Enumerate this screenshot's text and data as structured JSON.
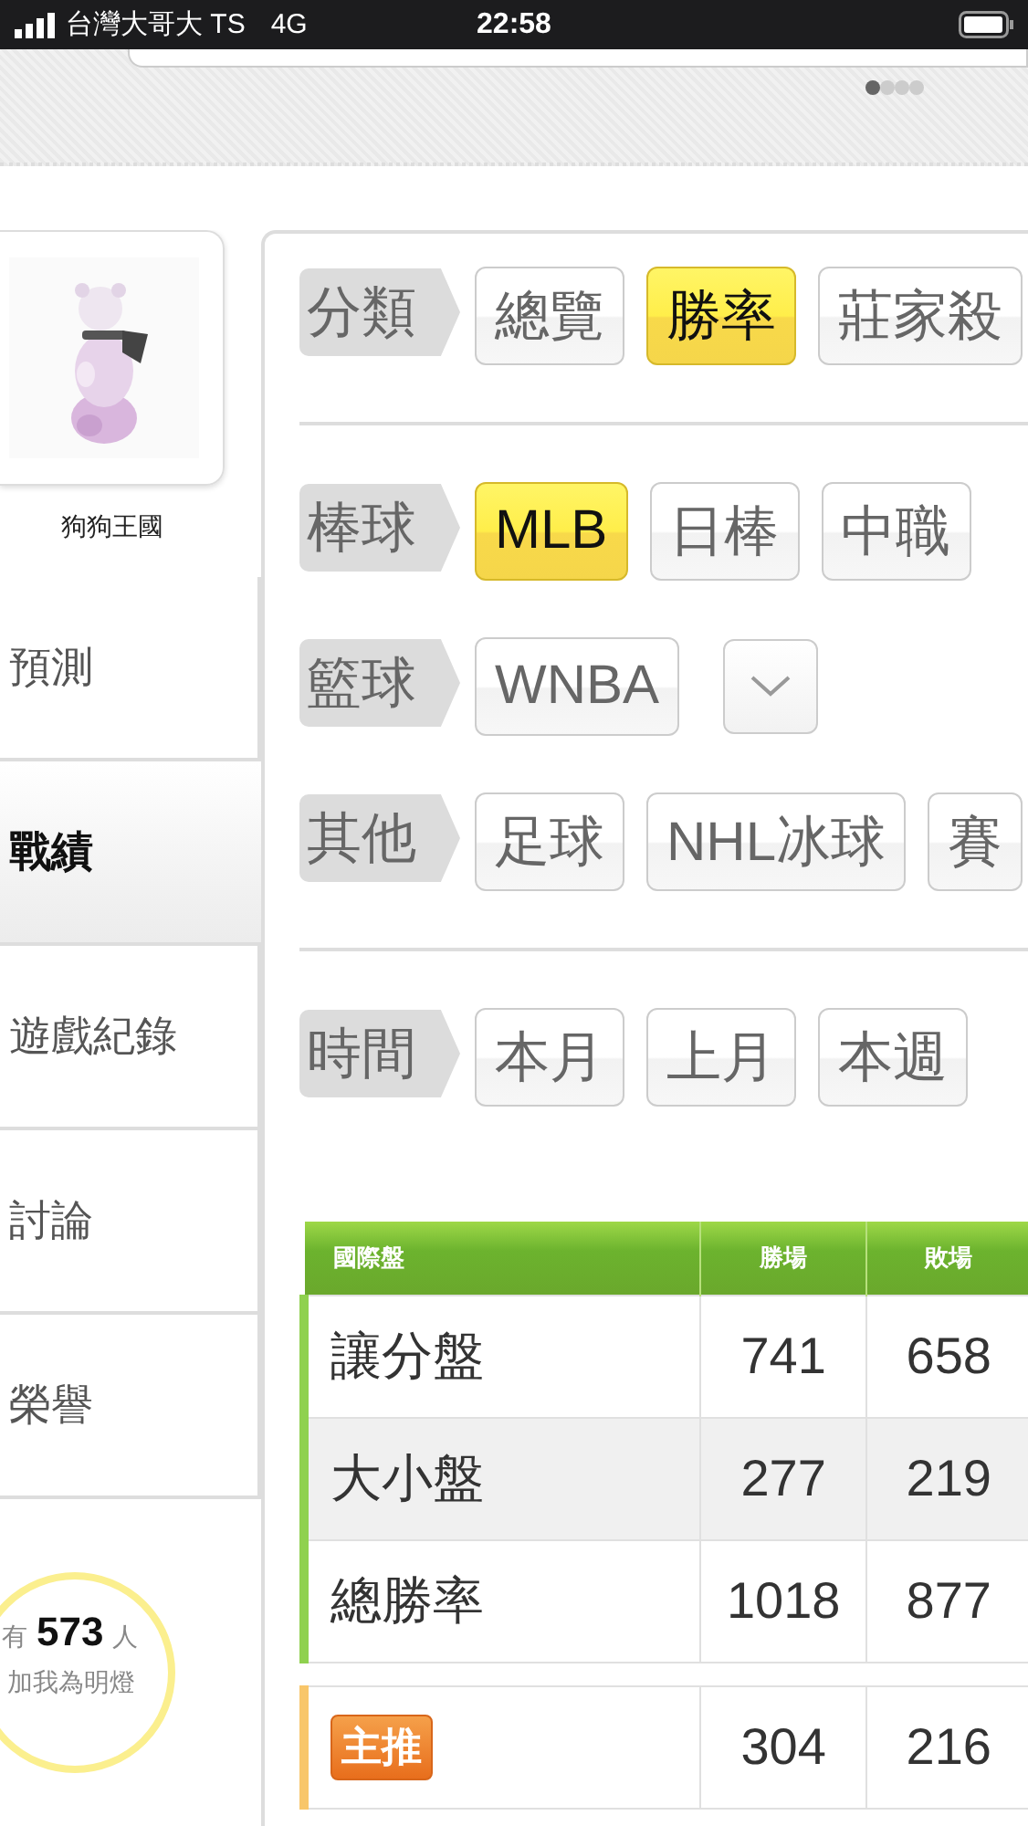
{
  "status_bar": {
    "carrier": "台灣大哥大 TS",
    "network": "4G",
    "time": "22:58"
  },
  "pager": [
    {
      "selected": true
    },
    {
      "selected": false
    },
    {
      "selected": false
    },
    {
      "selected": false
    }
  ],
  "profile": {
    "name": "狗狗王國"
  },
  "sidebar": {
    "items": [
      {
        "label": "預測",
        "selected": false
      },
      {
        "label": "戰績",
        "selected": true
      },
      {
        "label": "遊戲紀錄",
        "selected": false
      },
      {
        "label": "討論",
        "selected": false
      },
      {
        "label": "榮譽",
        "selected": false
      }
    ]
  },
  "lamp": {
    "prefix": "有",
    "count": "573",
    "suffix": "人",
    "caption": "加我為明燈"
  },
  "filters": [
    {
      "label": "分類",
      "options": [
        {
          "kind": "option",
          "label": "總覽",
          "selected": false
        },
        {
          "kind": "option",
          "label": "勝率",
          "selected": true
        },
        {
          "kind": "option",
          "label": "莊家殺",
          "selected": false
        }
      ]
    },
    {
      "kind": "divider"
    },
    {
      "label": "棒球",
      "options": [
        {
          "kind": "option",
          "label": "MLB",
          "selected": true
        },
        {
          "kind": "option",
          "label": "日棒",
          "selected": false
        },
        {
          "kind": "option",
          "label": "中職",
          "selected": false
        }
      ]
    },
    {
      "label": "籃球",
      "options": [
        {
          "kind": "option",
          "label": "WNBA",
          "selected": false
        },
        {
          "kind": "dropdown"
        }
      ]
    },
    {
      "label": "其他",
      "options": [
        {
          "kind": "option",
          "label": "足球",
          "selected": false
        },
        {
          "kind": "option",
          "label": "NHL冰球",
          "selected": false
        },
        {
          "kind": "option",
          "label": "賽",
          "selected": false
        }
      ]
    },
    {
      "kind": "divider"
    },
    {
      "label": "時間",
      "options": [
        {
          "kind": "option",
          "label": "本月",
          "selected": false
        },
        {
          "kind": "option",
          "label": "上月",
          "selected": false
        },
        {
          "kind": "option",
          "label": "本週",
          "selected": false
        }
      ]
    }
  ],
  "table": {
    "columns": [
      "國際盤",
      "勝場",
      "敗場"
    ],
    "rows": [
      {
        "kind": "normal",
        "cells": [
          "讓分盤",
          "741",
          "658"
        ]
      },
      {
        "kind": "normal",
        "cells": [
          "大小盤",
          "277",
          "219"
        ]
      },
      {
        "kind": "normal",
        "cells": [
          "總勝率",
          "1018",
          "877"
        ]
      },
      {
        "kind": "featured",
        "cells": [
          "主推",
          "304",
          "216"
        ]
      }
    ]
  }
}
